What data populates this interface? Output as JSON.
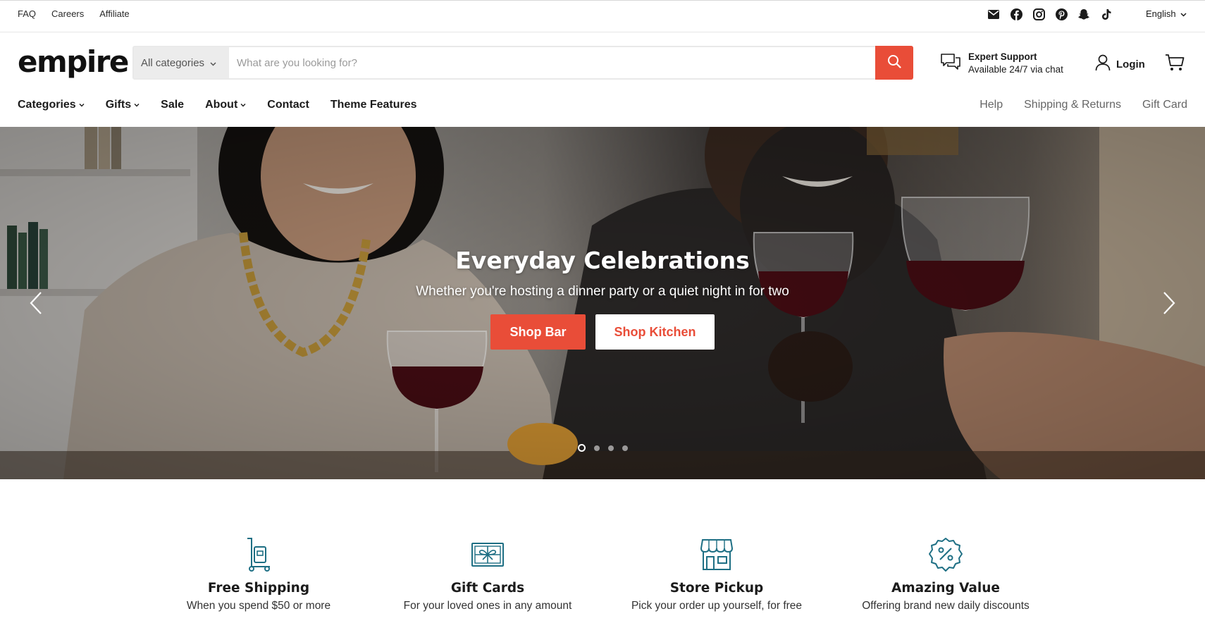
{
  "topbar": {
    "links": [
      "FAQ",
      "Careers",
      "Affiliate"
    ],
    "socials": [
      "mail-icon",
      "facebook-icon",
      "instagram-icon",
      "pinterest-icon",
      "snapchat-icon",
      "tiktok-icon"
    ],
    "language": "English"
  },
  "header": {
    "logo": "empire",
    "search": {
      "category": "All categories",
      "placeholder": "What are you looking for?",
      "button_icon": "search-icon"
    },
    "support": {
      "title": "Expert Support",
      "subtitle": "Available 24/7 via chat",
      "icon": "chat-bubbles-icon"
    },
    "login": "Login",
    "cart_icon": "cart-icon"
  },
  "nav": {
    "left": [
      {
        "label": "Categories",
        "dropdown": true
      },
      {
        "label": "Gifts",
        "dropdown": true
      },
      {
        "label": "Sale",
        "dropdown": false
      },
      {
        "label": "About",
        "dropdown": true
      },
      {
        "label": "Contact",
        "dropdown": false
      },
      {
        "label": "Theme Features",
        "dropdown": false
      }
    ],
    "right": [
      "Help",
      "Shipping & Returns",
      "Gift Card"
    ]
  },
  "hero": {
    "title": "Everyday Celebrations",
    "subtitle": "Whether you're hosting a dinner party or a quiet night in for two",
    "primary_button": "Shop Bar",
    "secondary_button": "Shop Kitchen",
    "slide_count": 4,
    "active_slide": 1
  },
  "features": [
    {
      "title": "Free Shipping",
      "subtitle": "When you spend $50 or more",
      "icon": "hand-truck-icon"
    },
    {
      "title": "Gift Cards",
      "subtitle": "For your loved ones in any amount",
      "icon": "gift-card-icon"
    },
    {
      "title": "Store Pickup",
      "subtitle": "Pick your order up yourself, for free",
      "icon": "storefront-icon"
    },
    {
      "title": "Amazing Value",
      "subtitle": "Offering brand new daily discounts",
      "icon": "discount-badge-icon"
    }
  ],
  "colors": {
    "accent": "#e94d38",
    "feature_icon": "#1e6f84",
    "text": "#1b1b1b"
  }
}
